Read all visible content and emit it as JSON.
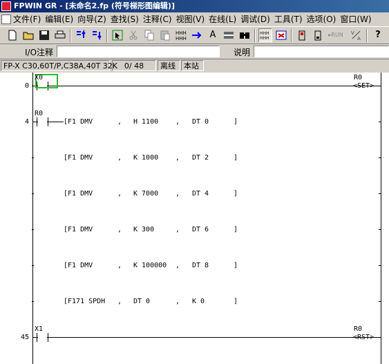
{
  "window": {
    "title": "FPWIN GR - [未命名2.fp (符号梯形图编辑)]"
  },
  "menu": [
    "文件(F)",
    "编辑(E)",
    "向导(Z)",
    "查找(S)",
    "注释(C)",
    "视图(V)",
    "在线(L)",
    "调试(D)",
    "工具(T)",
    "选项(O)",
    "窗口(W)"
  ],
  "toolbar": {
    "icons": [
      "new-file-icon",
      "open-folder-icon",
      "save-icon",
      "print-icon",
      "move-up-icon",
      "move-down-icon",
      "select-arrow-icon",
      "cut-icon",
      "copy-icon",
      "paste-icon",
      "insert-row-icon",
      "insert-icon",
      "text-icon",
      "delete-row-icon",
      "find-icon",
      "ladder-view-icon",
      "comment-view-icon",
      "monitor-icon",
      "online-icon",
      "run-mode-icon",
      "prog-mode-icon",
      "help-icon"
    ],
    "run_label": "RUN",
    "text_glyph": "A",
    "help_glyph": "?"
  },
  "comment_bar": {
    "io_label": "I/O注释",
    "io_value": "",
    "desc_label": "说明",
    "desc_value": ""
  },
  "status": {
    "plc": "FP-X C30,60T/P,C38A,40T 32K",
    "steps": "0/ 48",
    "mode": "离线",
    "station": "本站"
  },
  "ladder": {
    "rungs": [
      {
        "step": "0",
        "contact": "X0",
        "coil_operand": "R0",
        "coil": "<SET>"
      },
      {
        "step": "4",
        "contact": "R0",
        "instructions": [
          {
            "op": "[F1 DMV",
            "sep1": ",",
            "a": "H 1100",
            "sep2": ",",
            "b": "DT 0",
            "close": "]"
          },
          {
            "op": "[F1 DMV",
            "sep1": ",",
            "a": "K 1000",
            "sep2": ",",
            "b": "DT 2",
            "close": "]"
          },
          {
            "op": "[F1 DMV",
            "sep1": ",",
            "a": "K 7000",
            "sep2": ",",
            "b": "DT 4",
            "close": "]"
          },
          {
            "op": "[F1 DMV",
            "sep1": ",",
            "a": "K 300",
            "sep2": ",",
            "b": "DT 6",
            "close": "]"
          },
          {
            "op": "[F1 DMV",
            "sep1": ",",
            "a": "K 100000",
            "sep2": ",",
            "b": "DT 8",
            "close": "]"
          },
          {
            "op": "[F171 SPDH",
            "sep1": ",",
            "a": "DT 0",
            "sep2": ",",
            "b": "K 0",
            "close": "]"
          }
        ]
      },
      {
        "step": "45",
        "contact": "X1",
        "coil_operand": "R0",
        "coil": "<RST>"
      }
    ]
  }
}
